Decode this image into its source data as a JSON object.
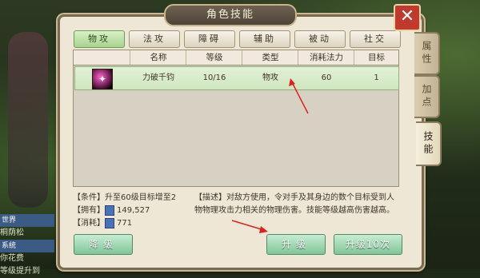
{
  "panel_title": "角色技能",
  "close_label": "✕",
  "filters": [
    "物攻",
    "法攻",
    "障碍",
    "辅助",
    "被动",
    "社交"
  ],
  "table": {
    "headers": [
      "名称",
      "等级",
      "类型",
      "消耗法力",
      "目标"
    ],
    "rows": [
      {
        "icon": "skill-icon",
        "name": "力破千钧",
        "level": "10/16",
        "type": "物攻",
        "mana": "60",
        "target": "1"
      }
    ]
  },
  "side_tabs": [
    "属性",
    "加点",
    "技能"
  ],
  "info": {
    "condition": "【条件】升至60级目标增至2",
    "owned_label": "【拥有】",
    "owned_value": "149,527",
    "cost_label": "【消耗】",
    "cost_value": "771"
  },
  "description": "【描述】对敌方使用，令对手及其身边的数个目标受到人物物理攻击力相关的物理伤害。技能等级越高伤害越高。",
  "buttons": {
    "downgrade": "降级",
    "upgrade": "升级",
    "upgrade10": "升级10次"
  },
  "background_chat": {
    "world_tag": "世界",
    "world_text": "桐荫松",
    "system_tag": "系统",
    "system_text": "你花费",
    "line3": "等级提升到"
  },
  "colors": {
    "accent_green": "#7fc699",
    "close_red": "#c0392b",
    "arrow_red": "#e02020"
  }
}
